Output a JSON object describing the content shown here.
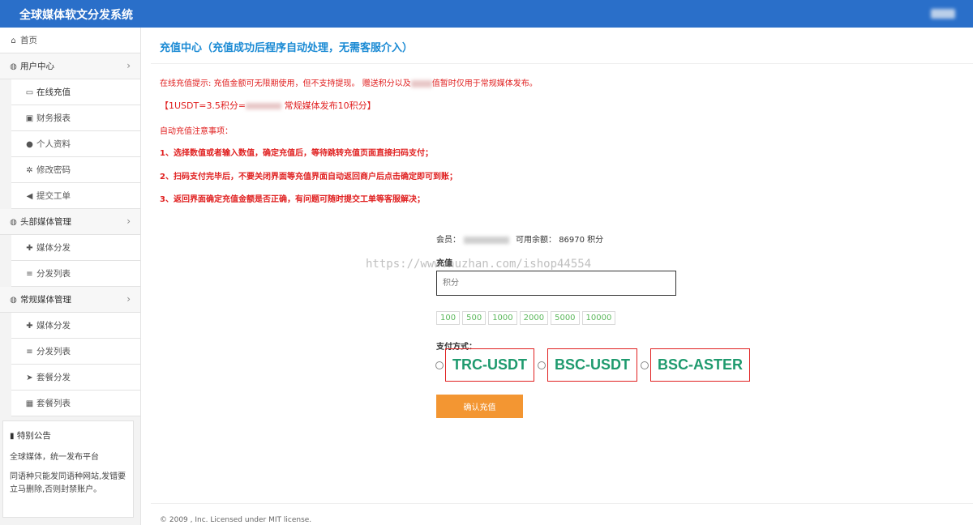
{
  "header": {
    "title": "全球媒体软文分发系统"
  },
  "sidebar": {
    "items": [
      {
        "icon": "home-icon",
        "glyph": "⌂",
        "label": "首页",
        "kind": "top"
      },
      {
        "icon": "globe-icon",
        "glyph": "◍",
        "label": "用户中心",
        "kind": "section",
        "chevron": "›"
      },
      {
        "icon": "credit-card-icon",
        "glyph": "▭",
        "label": "在线充值",
        "kind": "sub",
        "active": true
      },
      {
        "icon": "money-icon",
        "glyph": "▣",
        "label": "财务报表",
        "kind": "sub"
      },
      {
        "icon": "user-icon",
        "glyph": "●",
        "label": "个人资料",
        "kind": "sub"
      },
      {
        "icon": "gear-icon",
        "glyph": "✲",
        "label": "修改密码",
        "kind": "sub"
      },
      {
        "icon": "volume-icon",
        "glyph": "◀",
        "label": "提交工单",
        "kind": "sub"
      },
      {
        "icon": "globe-icon",
        "glyph": "◍",
        "label": "头部媒体管理",
        "kind": "section",
        "chevron": "›"
      },
      {
        "icon": "plus-icon",
        "glyph": "✚",
        "label": "媒体分发",
        "kind": "sub"
      },
      {
        "icon": "list-icon",
        "glyph": "≡",
        "label": "分发列表",
        "kind": "sub"
      },
      {
        "icon": "globe-icon",
        "glyph": "◍",
        "label": "常规媒体管理",
        "kind": "section",
        "chevron": "›"
      },
      {
        "icon": "plus-icon",
        "glyph": "✚",
        "label": "媒体分发",
        "kind": "sub"
      },
      {
        "icon": "list-icon",
        "glyph": "≡",
        "label": "分发列表",
        "kind": "sub"
      },
      {
        "icon": "send-icon",
        "glyph": "➤",
        "label": "套餐分发",
        "kind": "sub"
      },
      {
        "icon": "grid-icon",
        "glyph": "▦",
        "label": "套餐列表",
        "kind": "sub"
      }
    ],
    "notice": {
      "title": "特别公告",
      "icon": "bookmark-icon",
      "line1": "全球媒体，统一发布平台",
      "line2": "同语种只能发同语种网站,发错要立马删除,否则封禁账户。"
    }
  },
  "main": {
    "title": "充值中心（充值成功后程序自动处理，无需客服介入）",
    "tip_prefix": "在线充值提示: 充值金额可无限期使用，但不支持提现。 赠送积分以及",
    "tip_suffix": "值暂时仅用于常规媒体发布。",
    "rate_prefix": "【1USDT=3.5积分=",
    "rate_suffix": " 常规媒体发布10积分】",
    "notes_title": "自动充值注意事项：",
    "notes": [
      "1、选择数值或者输入数值，确定充值后，等待跳转充值页面直接扫码支付；",
      "2、扫码支付完毕后，不要关闭界面等充值界面自动返回商户后点击确定即可到账；",
      "3、返回界面确定充值金额是否正确，有问题可随时提交工单等客服解决；"
    ],
    "member_label": "会员：",
    "balance_label": "可用余额：",
    "balance_value": "86970 积分",
    "recharge_label": "充值",
    "amount_placeholder": "积分",
    "quick_amounts": [
      "100",
      "500",
      "1000",
      "2000",
      "5000",
      "10000"
    ],
    "pay_label": "支付方式：",
    "pay_methods": [
      "TRC-USDT",
      "BSC-USDT",
      "BSC-ASTER"
    ],
    "confirm_label": "确认充值",
    "watermark": "https://www.huzhan.com/ishop44554",
    "footer": "© 2009 , Inc. Licensed under MIT license."
  },
  "colors": {
    "header": "#2a6fc9",
    "title": "#1a8ad4",
    "alert": "#e02020",
    "pay_text": "#1f9a6e",
    "confirm": "#f39632"
  }
}
